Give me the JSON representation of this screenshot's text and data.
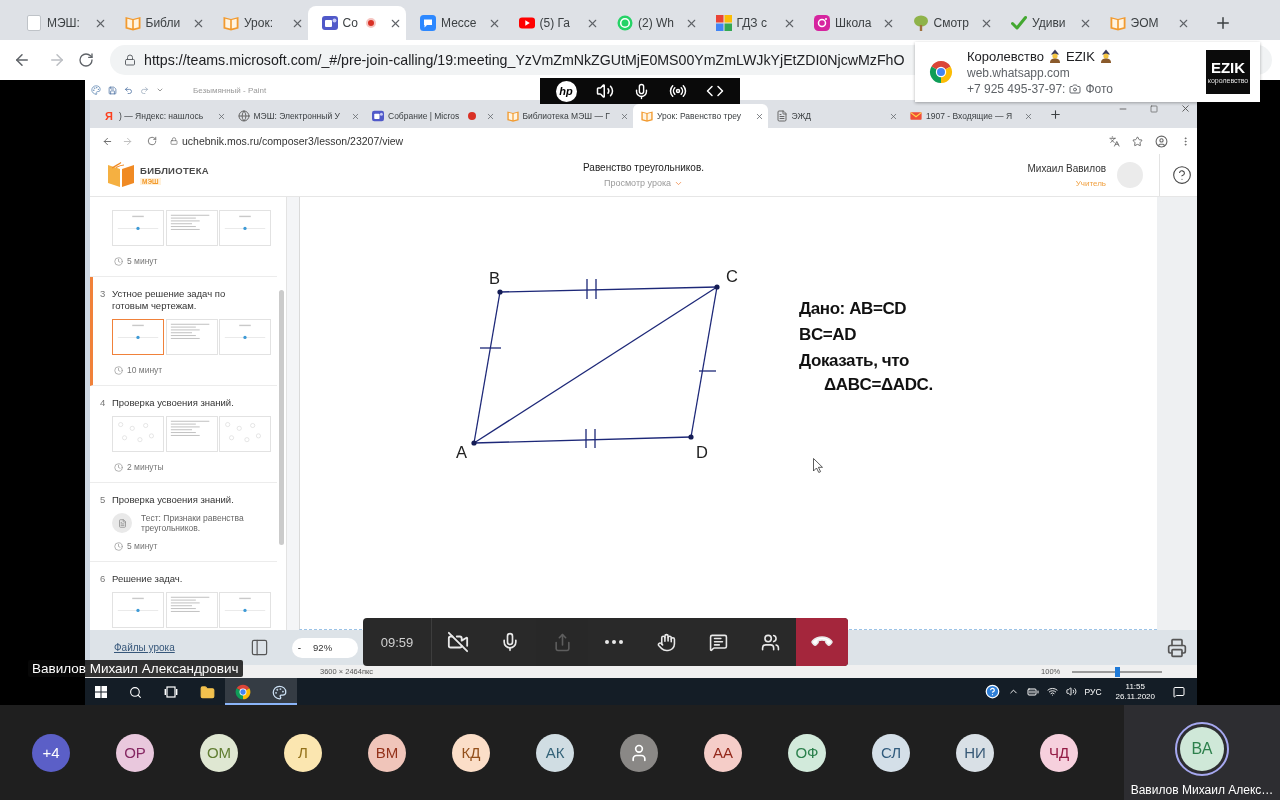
{
  "browser": {
    "tabs": [
      {
        "title": "МЭШ:",
        "selected": false,
        "recording": false
      },
      {
        "title": "Библи",
        "selected": false,
        "recording": false
      },
      {
        "title": "Урок:",
        "selected": false,
        "recording": false
      },
      {
        "title": "Со",
        "selected": true,
        "recording": true
      },
      {
        "title": "Мессе",
        "selected": false,
        "recording": false
      },
      {
        "title": "(5) Га",
        "selected": false,
        "recording": false
      },
      {
        "title": "(2) Wh",
        "selected": false,
        "recording": false
      },
      {
        "title": "ГДЗ с",
        "selected": false,
        "recording": false
      },
      {
        "title": "Школа",
        "selected": false,
        "recording": false
      },
      {
        "title": "Смотр",
        "selected": false,
        "recording": false
      },
      {
        "title": "Удиви",
        "selected": false,
        "recording": false
      },
      {
        "title": "ЭОМ",
        "selected": false,
        "recording": false
      }
    ],
    "url": "https://teams.microsoft.com/_#/pre-join-calling/19:meeting_YzVmZmNkZGUtMjE0MS00YmZmLWJkYjEtZDI0NjcwMzFhO"
  },
  "notification": {
    "title": [
      "Королевство",
      "EZIK"
    ],
    "source": "web.whatsapp.com",
    "sender": "+7 925 495-37-97:",
    "attachment": "Фото",
    "logo_text": "EZIK",
    "logo_caption": "королевство"
  },
  "shared_screen": {
    "paint_title": "Безымянный - Paint",
    "hp_bar": {
      "logo": "hp"
    },
    "inner_browser": {
      "tabs": [
        {
          "title": ") — Яндекс: нашлось",
          "glyph": "Я",
          "selected": false,
          "recording": false
        },
        {
          "title": "МЭШ: Электронный У",
          "selected": false,
          "recording": false
        },
        {
          "title": "Собрание | Micros",
          "selected": false,
          "recording": true
        },
        {
          "title": "Библиотека МЭШ — Г",
          "selected": false,
          "recording": false
        },
        {
          "title": "Урок: Равенство треу",
          "selected": true,
          "recording": false
        },
        {
          "title": "ЭЖД",
          "selected": false,
          "recording": false
        },
        {
          "title": "1907 - Входящие — Я",
          "selected": false,
          "recording": false
        }
      ],
      "url": "uchebnik.mos.ru/composer3/lesson/23207/view"
    },
    "site_header": {
      "logo_title": "БИБЛИОТЕКА",
      "logo_badge": "МЭШ",
      "lesson_title": "Равенство треугольников.",
      "view_mode": "Просмотр урока",
      "user_name": "Михаил Вавилов",
      "user_role": "Учитель"
    },
    "sidebar": {
      "items": [
        {
          "kind": "slides",
          "selected": false,
          "thumbnails": [
            {
              "kind": "figure",
              "selected": false
            },
            {
              "kind": "text",
              "selected": false
            },
            {
              "kind": "figure",
              "selected": false
            }
          ],
          "duration": "5 минут"
        },
        {
          "kind": "slides",
          "number": "3",
          "title": "Устное решение задач по готовым чертежам.",
          "selected": true,
          "thumbnails": [
            {
              "kind": "figure",
              "selected": true
            },
            {
              "kind": "text",
              "selected": false
            },
            {
              "kind": "figure",
              "selected": false
            }
          ],
          "duration": "10 минут"
        },
        {
          "kind": "slides",
          "number": "4",
          "title": "Проверка усвоения знаний.",
          "selected": false,
          "thumbnails": [
            {
              "kind": "sketch",
              "selected": false
            },
            {
              "kind": "text",
              "selected": false
            },
            {
              "kind": "sketch",
              "selected": false
            }
          ],
          "duration": "2 минуты"
        },
        {
          "kind": "test",
          "number": "5",
          "title": "Проверка усвоения знаний.",
          "selected": false,
          "test_title": "Тест: Признаки равенства треугольников.",
          "duration": "5 минут"
        },
        {
          "kind": "slides",
          "number": "6",
          "title": "Решение задач.",
          "selected": false,
          "thumbnails": [
            {
              "kind": "figure",
              "selected": false
            },
            {
              "kind": "text",
              "selected": false
            },
            {
              "kind": "figure",
              "selected": false
            }
          ]
        }
      ]
    },
    "slide": {
      "vertices": [
        {
          "label": "A"
        },
        {
          "label": "B"
        },
        {
          "label": "C"
        },
        {
          "label": "D"
        }
      ],
      "statement": [
        {
          "kind": "line",
          "text": "Дано: AB=CD"
        },
        {
          "kind": "line",
          "text": "BC=AD"
        },
        {
          "kind": "line",
          "text": "Доказать, что"
        },
        {
          "kind": "indented",
          "text": "ΔABC=ΔADC."
        }
      ]
    },
    "footer": {
      "files_link": "Файлы урока",
      "zoom_minus": "-",
      "zoom_value": "92%"
    },
    "paint_status": {
      "dimensions": "3600 × 2464пкс",
      "zoom": "100%",
      "zoom_slider": {
        "level": 0.5
      }
    },
    "taskbar": {
      "apps": [
        {
          "kind": "start",
          "active": false
        },
        {
          "kind": "search",
          "active": false
        },
        {
          "kind": "task_view",
          "active": false
        },
        {
          "kind": "explorer",
          "active": false
        },
        {
          "kind": "chrome",
          "active": true
        },
        {
          "kind": "paint",
          "active": true
        }
      ],
      "language": "РУС",
      "time": "11:55",
      "date": "26.11.2020"
    }
  },
  "presenter_name": "Вавилов Михаил Александрович",
  "call_toolbar": {
    "timer": "09:59",
    "toggles": [
      {
        "kind": "camera",
        "on": false
      },
      {
        "kind": "mic",
        "on": true
      }
    ],
    "actions": [
      {
        "kind": "share",
        "disabled": true
      },
      {
        "kind": "more",
        "disabled": false
      },
      {
        "kind": "raise_hand",
        "disabled": false
      },
      {
        "kind": "chat",
        "disabled": false
      },
      {
        "kind": "participants",
        "disabled": false
      },
      {
        "kind": "leave",
        "disabled": false
      }
    ]
  },
  "participants": [
    {
      "kind": "initials",
      "initials": "+4",
      "color": "#5b5fc7"
    },
    {
      "kind": "initials",
      "initials": "ОР",
      "color": "#e9c8dd"
    },
    {
      "kind": "initials",
      "initials": "ОМ",
      "color": "#dfe7d2"
    },
    {
      "kind": "initials",
      "initials": "Л",
      "color": "#fbe6b0"
    },
    {
      "kind": "initials",
      "initials": "ВМ",
      "color": "#f0c5ba"
    },
    {
      "kind": "initials",
      "initials": "КД",
      "color": "#fbdec8"
    },
    {
      "kind": "initials",
      "initials": "АК",
      "color": "#d0dde3"
    },
    {
      "kind": "anonymous",
      "color": "#8a8886"
    },
    {
      "kind": "initials",
      "initials": "АА",
      "color": "#f5cdc8"
    },
    {
      "kind": "initials",
      "initials": "ОФ",
      "color": "#d2eadb"
    },
    {
      "kind": "initials",
      "initials": "СЛ",
      "color": "#d4dfe8"
    },
    {
      "kind": "initials",
      "initials": "НИ",
      "color": "#d9e0e6"
    },
    {
      "kind": "initials",
      "initials": "ЧД",
      "color": "#f6d0dd"
    }
  ],
  "self": {
    "initials": "ВА",
    "name": "Вавилов Михаил Алекс…",
    "color": "#cfe8d8",
    "speaking": true
  }
}
